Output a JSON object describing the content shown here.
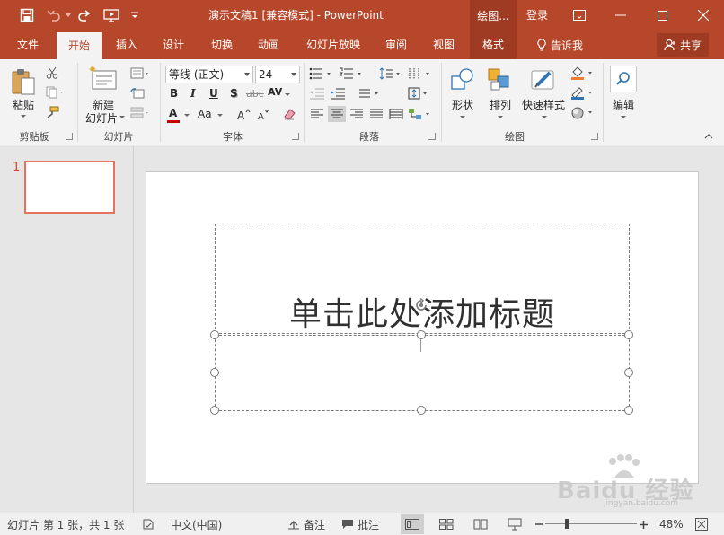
{
  "window": {
    "title": "演示文稿1 [兼容模式] - PowerPoint",
    "context_tab": "绘图...",
    "login": "登录"
  },
  "tabs": [
    {
      "label": "文件"
    },
    {
      "label": "开始",
      "active": true
    },
    {
      "label": "插入"
    },
    {
      "label": "设计"
    },
    {
      "label": "切换"
    },
    {
      "label": "动画"
    },
    {
      "label": "幻灯片放映"
    },
    {
      "label": "审阅"
    },
    {
      "label": "视图"
    },
    {
      "label": "格式"
    }
  ],
  "tell_me": "告诉我",
  "share": "共享",
  "ribbon": {
    "clipboard": {
      "label": "剪贴板",
      "paste": "粘贴"
    },
    "slides": {
      "label": "幻灯片",
      "new_slide_line1": "新建",
      "new_slide_line2": "幻灯片"
    },
    "font": {
      "label": "字体",
      "font_name": "等线 (正文)",
      "font_size": "24",
      "bold": "B",
      "italic": "I",
      "underline": "U",
      "shadow": "S",
      "strike": "abc",
      "spacing": "AV",
      "color": "A",
      "case": "Aa"
    },
    "paragraph": {
      "label": "段落"
    },
    "drawing": {
      "label": "绘图",
      "shape": "形状",
      "arrange": "排列",
      "quick_styles": "快速样式"
    },
    "editing": {
      "label": "编辑"
    }
  },
  "thumbnail": {
    "number": "1"
  },
  "slide": {
    "title_placeholder": "单击此处添加标题"
  },
  "watermark": {
    "text": "Baidu 经验",
    "sub": "jingyan.baidu.com"
  },
  "status": {
    "slide_info": "幻灯片 第 1 张，共 1 张",
    "language": "中文(中国)",
    "notes": "备注",
    "comments": "批注",
    "zoom": "48%"
  },
  "colors": {
    "accent": "#b7472a",
    "accent_dark": "#9e3b22",
    "selected_thumb": "#e1745a"
  }
}
